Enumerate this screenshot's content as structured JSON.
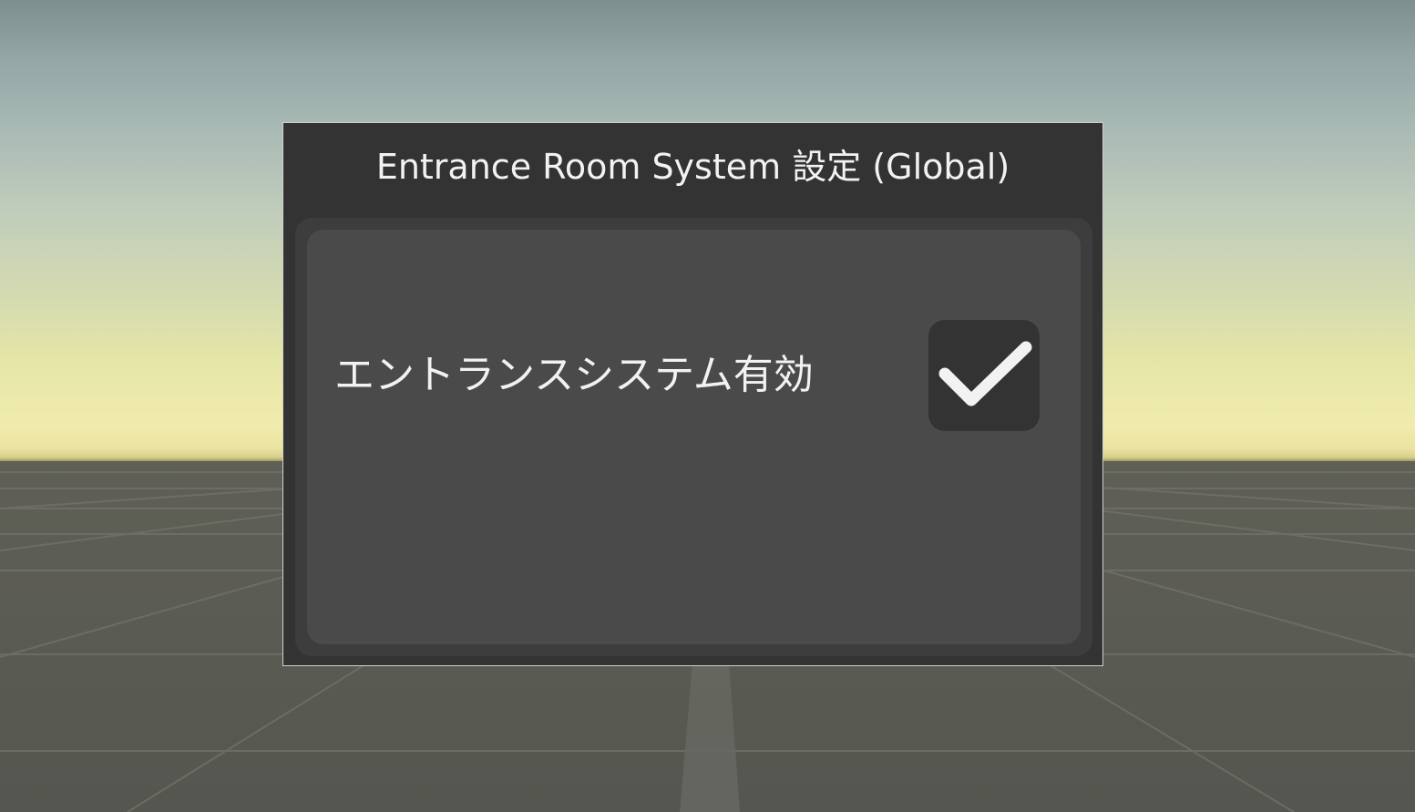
{
  "panel": {
    "title": "Entrance Room System 設定 (Global)",
    "toggle": {
      "label": "エントランスシステム有効",
      "checked": true
    }
  },
  "colors": {
    "panel_background": "#333333",
    "panel_body": "#4a4a4a",
    "checkmark": "#f2f2f2",
    "text": "#f2f2f2"
  },
  "icons": {
    "checkmark": "check-icon"
  }
}
